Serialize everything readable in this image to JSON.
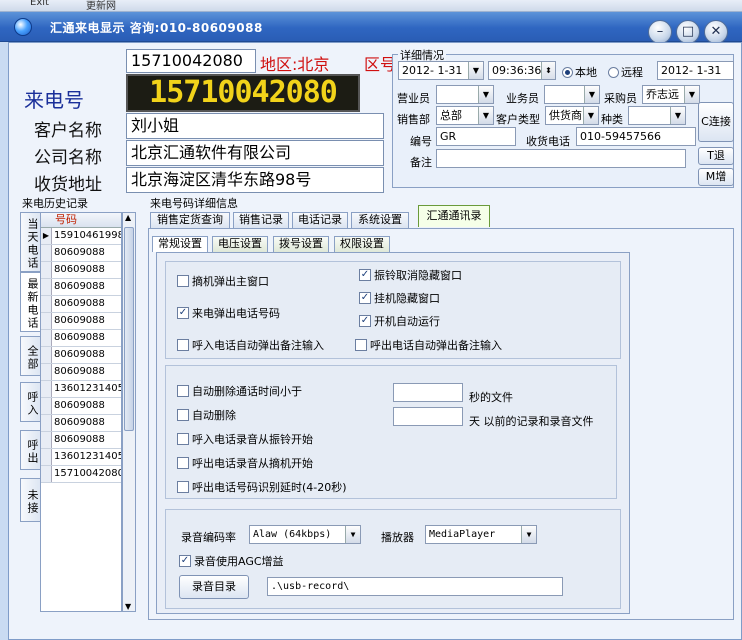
{
  "title": "汇通来电显示 咨询:010-80609088",
  "toolbar_fragments": [
    "Exit",
    "更新网"
  ],
  "caller": {
    "number": "15710042080",
    "region": "地区:北京",
    "region_tail": "区号",
    "led": "15710042080",
    "label_number": "来电号",
    "label_customer": "客户名称",
    "customer": "刘小姐",
    "label_company": "公司名称",
    "company": "北京汇通软件有限公司",
    "label_address": "收货地址",
    "address": "北京海淀区清华东路98号"
  },
  "detail": {
    "title": "详细情况",
    "date1": "2012- 1-31",
    "time1": "09:36:36",
    "radio_local": "本地",
    "radio_remote": "远程",
    "date2": "2012- 1-31",
    "label_sales": "营业员",
    "label_staff": "业务员",
    "label_buyer": "采购员",
    "buyer": "乔志远",
    "label_dept": "销售部",
    "dept": "总部",
    "label_custtype": "客户类型",
    "custtype": "供货商",
    "label_kind": "种类",
    "label_code": "编号",
    "code": "GR",
    "label_phone": "收货电话",
    "phone": "010-59457566",
    "label_note": "备注",
    "btn_connect": "C连接",
    "btn_exit": "T退",
    "btn_more": "M增"
  },
  "history": {
    "title": "来电历史记录",
    "col_header": "号码",
    "tabs": [
      "当天电话",
      "最新电话",
      "全部",
      "呼入",
      "呼出",
      "未接"
    ],
    "rows": [
      "15910461998",
      "80609088",
      "80609088",
      "80609088",
      "80609088",
      "80609088",
      "80609088",
      "80609088",
      "80609088",
      "13601231405",
      "80609088",
      "80609088",
      "80609088",
      "13601231405",
      "15710042080"
    ]
  },
  "detail_tabs": {
    "title": "来电号码详细信息",
    "main": [
      "销售定货查询",
      "销售记录",
      "电话记录",
      "系统设置",
      "汇通通讯录"
    ],
    "sub": [
      "常规设置",
      "电压设置",
      "拨号设置",
      "权限设置"
    ]
  },
  "settings": {
    "opt_pickup_popup": "摘机弹出主窗口",
    "opt_ring_hide": "振铃取消隐藏窗口",
    "opt_hangup_hide": "挂机隐藏窗口",
    "opt_incoming_popup_number": "来电弹出电话号码",
    "opt_autorun": "开机自动运行",
    "opt_in_note": "呼入电话自动弹出备注输入",
    "opt_out_note": "呼出电话自动弹出备注输入",
    "opt_autodel_short": "自动删除通话时间小于",
    "suffix_seconds": "秒的文件",
    "opt_autodel": "自动删除",
    "suffix_days": "天 以前的记录和录音文件",
    "opt_in_rec_ring": "呼入电话录音从振铃开始",
    "opt_out_rec_pickup": "呼出电话录音从摘机开始",
    "opt_out_delay": "呼出电话号码识别延时(4-20秒)",
    "label_bitrate": "录音编码率",
    "bitrate": "Alaw (64kbps)",
    "label_player": "播放器",
    "player": "MediaPlayer",
    "opt_agc": "录音使用AGC增益",
    "btn_recdir": "录音目录",
    "recdir": ".\\usb-record\\"
  },
  "colors": {
    "title_bg": "#2f66c1",
    "led_text": "#f2d31a",
    "region": "#d01010",
    "number_label": "#1a2f9a"
  }
}
